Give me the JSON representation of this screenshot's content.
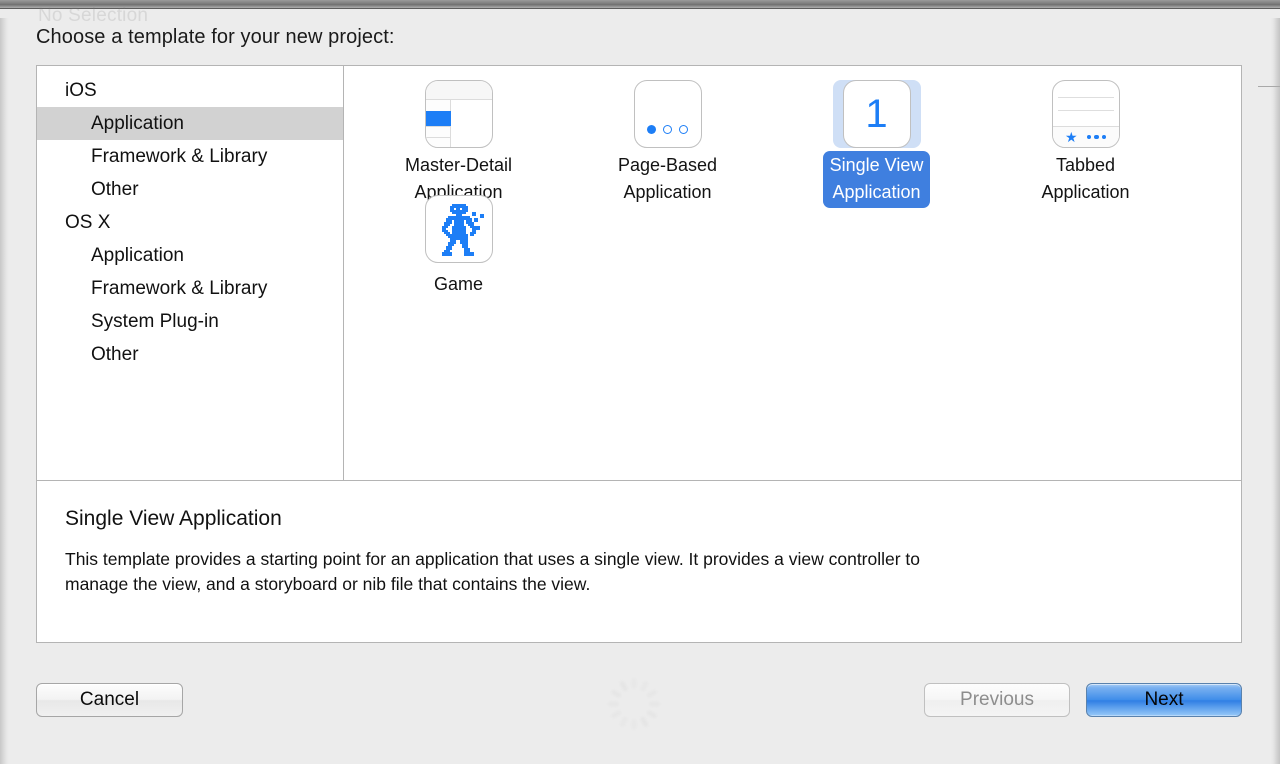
{
  "window": {
    "ghost_title": "No Selection",
    "prompt": "Choose a template for your new project:"
  },
  "sidebar": {
    "groups": [
      {
        "name": "iOS",
        "items": [
          {
            "label": "Application",
            "selected": true
          },
          {
            "label": "Framework & Library",
            "selected": false
          },
          {
            "label": "Other",
            "selected": false
          }
        ]
      },
      {
        "name": "OS X",
        "items": [
          {
            "label": "Application",
            "selected": false
          },
          {
            "label": "Framework & Library",
            "selected": false
          },
          {
            "label": "System Plug-in",
            "selected": false
          },
          {
            "label": "Other",
            "selected": false
          }
        ]
      }
    ]
  },
  "templates": [
    {
      "label": "Master-Detail\nApplication",
      "icon": "master-detail-icon",
      "selected": false
    },
    {
      "label": "Page-Based\nApplication",
      "icon": "page-based-icon",
      "selected": false
    },
    {
      "label": "Single View\nApplication",
      "icon": "single-view-icon",
      "selected": true,
      "badge_number": "1"
    },
    {
      "label": "Tabbed\nApplication",
      "icon": "tabbed-icon",
      "selected": false
    },
    {
      "label": "Game",
      "icon": "game-robot-icon",
      "selected": false
    }
  ],
  "description": {
    "title": "Single View Application",
    "body": "This template provides a starting point for an application that uses a single view. It provides a view controller to manage the view, and a storyboard or nib file that contains the view."
  },
  "footer": {
    "cancel_label": "Cancel",
    "previous_label": "Previous",
    "next_label": "Next"
  },
  "colors": {
    "accent_blue": "#1d7ef6",
    "selection_pill": "#3f7fdf",
    "selection_icon_bg": "#cfdff6",
    "sidebar_selected_bg": "#d2d2d2",
    "window_bg": "#ececec",
    "panel_border": "#b4b4b4",
    "default_button_blue": "#3f8de9"
  }
}
